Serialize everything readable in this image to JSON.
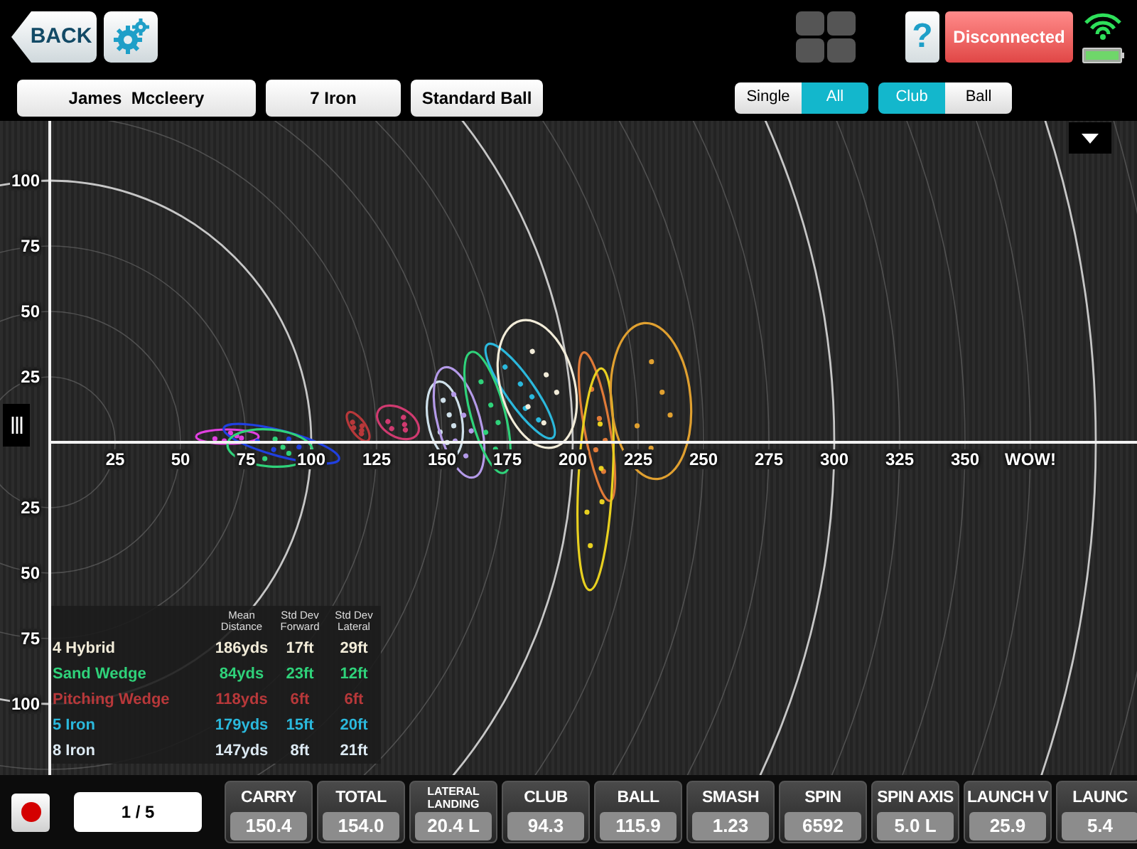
{
  "top_bar": {
    "back_button": "BACK",
    "help_button": "?",
    "connection_status": "Disconnected"
  },
  "selectors": {
    "player": "James  Mccleery",
    "club": "7 Iron",
    "ball": "Standard Ball"
  },
  "toggles": [
    [
      {
        "label": "Single",
        "selected": false
      },
      {
        "label": "All",
        "selected": true
      }
    ],
    [
      {
        "label": "Club",
        "selected": true
      },
      {
        "label": "Ball",
        "selected": false
      }
    ]
  ],
  "chart": {
    "x_tick_labels": [
      "25",
      "50",
      "75",
      "100",
      "125",
      "150",
      "175",
      "200",
      "225",
      "250",
      "275",
      "300",
      "325",
      "350",
      "WOW!"
    ],
    "y_tick_labels_above": [
      "100",
      "75",
      "50",
      "25"
    ],
    "y_tick_labels_below": [
      "25",
      "50",
      "75",
      "100"
    ]
  },
  "legend": {
    "columns": [
      "Mean Distance",
      "Std Dev Forward",
      "Std Dev Lateral"
    ],
    "rows": [
      {
        "club": "4 Hybrid",
        "mean": "186yds",
        "forward": "17ft",
        "lateral": "29ft",
        "color": "#f2ecd9"
      },
      {
        "club": "Sand Wedge",
        "mean": "84yds",
        "forward": "23ft",
        "lateral": "12ft",
        "color": "#2fd27a"
      },
      {
        "club": "Pitching Wedge",
        "mean": "118yds",
        "forward": "6ft",
        "lateral": "6ft",
        "color": "#b8383a"
      },
      {
        "club": "5 Iron",
        "mean": "179yds",
        "forward": "15ft",
        "lateral": "20ft",
        "color": "#2bb8dc"
      },
      {
        "club": "8 Iron",
        "mean": "147yds",
        "forward": "8ft",
        "lateral": "21ft",
        "color": "#dce9f2"
      }
    ]
  },
  "bottom_bar": {
    "recording": true,
    "shot_counter": "1 / 5",
    "metrics": [
      {
        "label": "CARRY",
        "value": "150.4"
      },
      {
        "label": "TOTAL",
        "value": "154.0"
      },
      {
        "label": "LATERAL LANDING",
        "value": "20.4 L"
      },
      {
        "label": "CLUB",
        "value": "94.3"
      },
      {
        "label": "BALL",
        "value": "115.9"
      },
      {
        "label": "SMASH",
        "value": "1.23"
      },
      {
        "label": "SPIN",
        "value": "6592"
      },
      {
        "label": "SPIN AXIS",
        "value": "5.0 L"
      },
      {
        "label": "LAUNCH V",
        "value": "25.9"
      },
      {
        "label": "LAUNC",
        "value": "5.4"
      }
    ]
  }
}
